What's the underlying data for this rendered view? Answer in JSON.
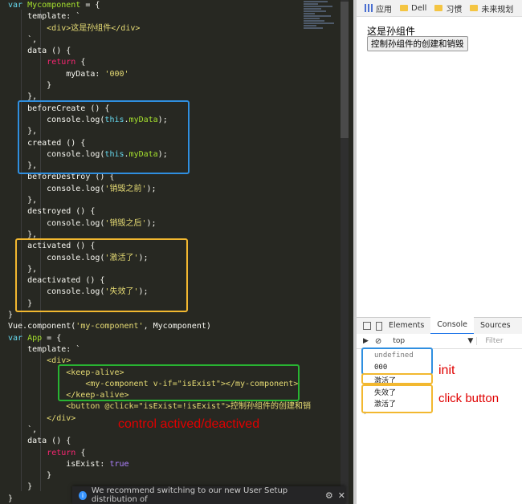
{
  "editor": {
    "code_lines": [
      [
        {
          "t": "var ",
          "c": "#66d9ef"
        },
        {
          "t": "Mycomponent",
          "c": "#a6e22e"
        },
        {
          "t": " = {",
          "c": "#f8f8f2"
        }
      ],
      [
        {
          "t": "    template: `",
          "c": "#f8f8f2"
        }
      ],
      [
        {
          "t": "        <div>这是孙组件</div>",
          "c": "#e6db74"
        }
      ],
      [
        {
          "t": "    `,",
          "c": "#f8f8f2"
        }
      ],
      [
        {
          "t": "    data () {",
          "c": "#f8f8f2"
        }
      ],
      [
        {
          "t": "        ",
          "c": "#f8f8f2"
        },
        {
          "t": "return",
          "c": "#f92672"
        },
        {
          "t": " {",
          "c": "#f8f8f2"
        }
      ],
      [
        {
          "t": "            myData: ",
          "c": "#f8f8f2"
        },
        {
          "t": "'000'",
          "c": "#e6db74"
        }
      ],
      [
        {
          "t": "        }",
          "c": "#f8f8f2"
        }
      ],
      [
        {
          "t": "    },",
          "c": "#f8f8f2"
        }
      ],
      [
        {
          "t": "    beforeCreate () {",
          "c": "#f8f8f2"
        }
      ],
      [
        {
          "t": "        console.log(",
          "c": "#f8f8f2"
        },
        {
          "t": "this",
          "c": "#66d9ef"
        },
        {
          "t": ".",
          "c": "#f8f8f2"
        },
        {
          "t": "myData",
          "c": "#a6e22e"
        },
        {
          "t": ");",
          "c": "#f8f8f2"
        }
      ],
      [
        {
          "t": "    },",
          "c": "#f8f8f2"
        }
      ],
      [
        {
          "t": "    created () {",
          "c": "#f8f8f2"
        }
      ],
      [
        {
          "t": "        console.log(",
          "c": "#f8f8f2"
        },
        {
          "t": "this",
          "c": "#66d9ef"
        },
        {
          "t": ".",
          "c": "#f8f8f2"
        },
        {
          "t": "myData",
          "c": "#a6e22e"
        },
        {
          "t": ");",
          "c": "#f8f8f2"
        }
      ],
      [
        {
          "t": "    },",
          "c": "#f8f8f2"
        }
      ],
      [
        {
          "t": "    beforeDestroy () {",
          "c": "#f8f8f2"
        }
      ],
      [
        {
          "t": "        console.log(",
          "c": "#f8f8f2"
        },
        {
          "t": "'销毁之前'",
          "c": "#e6db74"
        },
        {
          "t": ");",
          "c": "#f8f8f2"
        }
      ],
      [
        {
          "t": "    },",
          "c": "#f8f8f2"
        }
      ],
      [
        {
          "t": "    destroyed () {",
          "c": "#f8f8f2"
        }
      ],
      [
        {
          "t": "        console.log(",
          "c": "#f8f8f2"
        },
        {
          "t": "'销毁之后'",
          "c": "#e6db74"
        },
        {
          "t": ");",
          "c": "#f8f8f2"
        }
      ],
      [
        {
          "t": "    },",
          "c": "#f8f8f2"
        }
      ],
      [
        {
          "t": "    activated () {",
          "c": "#f8f8f2"
        }
      ],
      [
        {
          "t": "        console.log(",
          "c": "#f8f8f2"
        },
        {
          "t": "'激活了'",
          "c": "#e6db74"
        },
        {
          "t": ");",
          "c": "#f8f8f2"
        }
      ],
      [
        {
          "t": "    },",
          "c": "#f8f8f2"
        }
      ],
      [
        {
          "t": "    deactivated () {",
          "c": "#f8f8f2"
        }
      ],
      [
        {
          "t": "        console.log(",
          "c": "#f8f8f2"
        },
        {
          "t": "'失效了'",
          "c": "#e6db74"
        },
        {
          "t": ");",
          "c": "#f8f8f2"
        }
      ],
      [
        {
          "t": "    }",
          "c": "#f8f8f2"
        }
      ],
      [
        {
          "t": "}",
          "c": "#f8f8f2"
        }
      ],
      [
        {
          "t": "Vue.component(",
          "c": "#f8f8f2"
        },
        {
          "t": "'my-component'",
          "c": "#e6db74"
        },
        {
          "t": ", Mycomponent)",
          "c": "#f8f8f2"
        }
      ],
      [
        {
          "t": "var ",
          "c": "#66d9ef"
        },
        {
          "t": "App",
          "c": "#a6e22e"
        },
        {
          "t": " = {",
          "c": "#f8f8f2"
        }
      ],
      [
        {
          "t": "    template: `",
          "c": "#f8f8f2"
        }
      ],
      [
        {
          "t": "        <div>",
          "c": "#e6db74"
        }
      ],
      [
        {
          "t": "            <keep-alive>",
          "c": "#e6db74"
        }
      ],
      [
        {
          "t": "                <my-component v-if=\"isExist\"></my-component>",
          "c": "#e6db74"
        }
      ],
      [
        {
          "t": "            </keep-alive>",
          "c": "#e6db74"
        }
      ],
      [
        {
          "t": "            <button @click=\"isExist=!isExist\">控制孙组件的创建和销",
          "c": "#e6db74"
        }
      ],
      [
        {
          "t": "        </div>",
          "c": "#e6db74"
        }
      ],
      [
        {
          "t": "    `,",
          "c": "#f8f8f2"
        }
      ],
      [
        {
          "t": "    data () {",
          "c": "#f8f8f2"
        }
      ],
      [
        {
          "t": "        ",
          "c": "#f8f8f2"
        },
        {
          "t": "return",
          "c": "#f92672"
        },
        {
          "t": " {",
          "c": "#f8f8f2"
        }
      ],
      [
        {
          "t": "            isExist: ",
          "c": "#f8f8f2"
        },
        {
          "t": "true",
          "c": "#ae81ff"
        }
      ],
      [
        {
          "t": "        }",
          "c": "#f8f8f2"
        }
      ],
      [
        {
          "t": "    }",
          "c": "#f8f8f2"
        }
      ],
      [
        {
          "t": "}",
          "c": "#f8f8f2"
        }
      ]
    ],
    "notification": "We recommend switching to our new User Setup distribution of",
    "annotation_control": "control actived/deactived",
    "colors": {
      "blue_box": "#2f8fe0",
      "yellow_box": "#f2b830",
      "green_box": "#28b432",
      "annotation": "#e00000"
    }
  },
  "browser": {
    "bookmarks": [
      {
        "label": "应用",
        "icon": "apps-grid-icon"
      },
      {
        "label": "Dell",
        "icon": "folder-icon"
      },
      {
        "label": "习惯",
        "icon": "folder-icon"
      },
      {
        "label": "未来规划",
        "icon": "folder-icon"
      }
    ],
    "page_text": "这是孙组件",
    "page_button": "控制孙组件的创建和销毁",
    "devtools_tabs": [
      "Elements",
      "Console",
      "Sources"
    ],
    "active_tab": "Console",
    "console_context": "top",
    "console_filter": "Filter",
    "console_lines": [
      "undefined",
      "000",
      "激活了",
      "失效了",
      "激活了"
    ],
    "annotations": {
      "init": "init",
      "click": "click button"
    }
  }
}
